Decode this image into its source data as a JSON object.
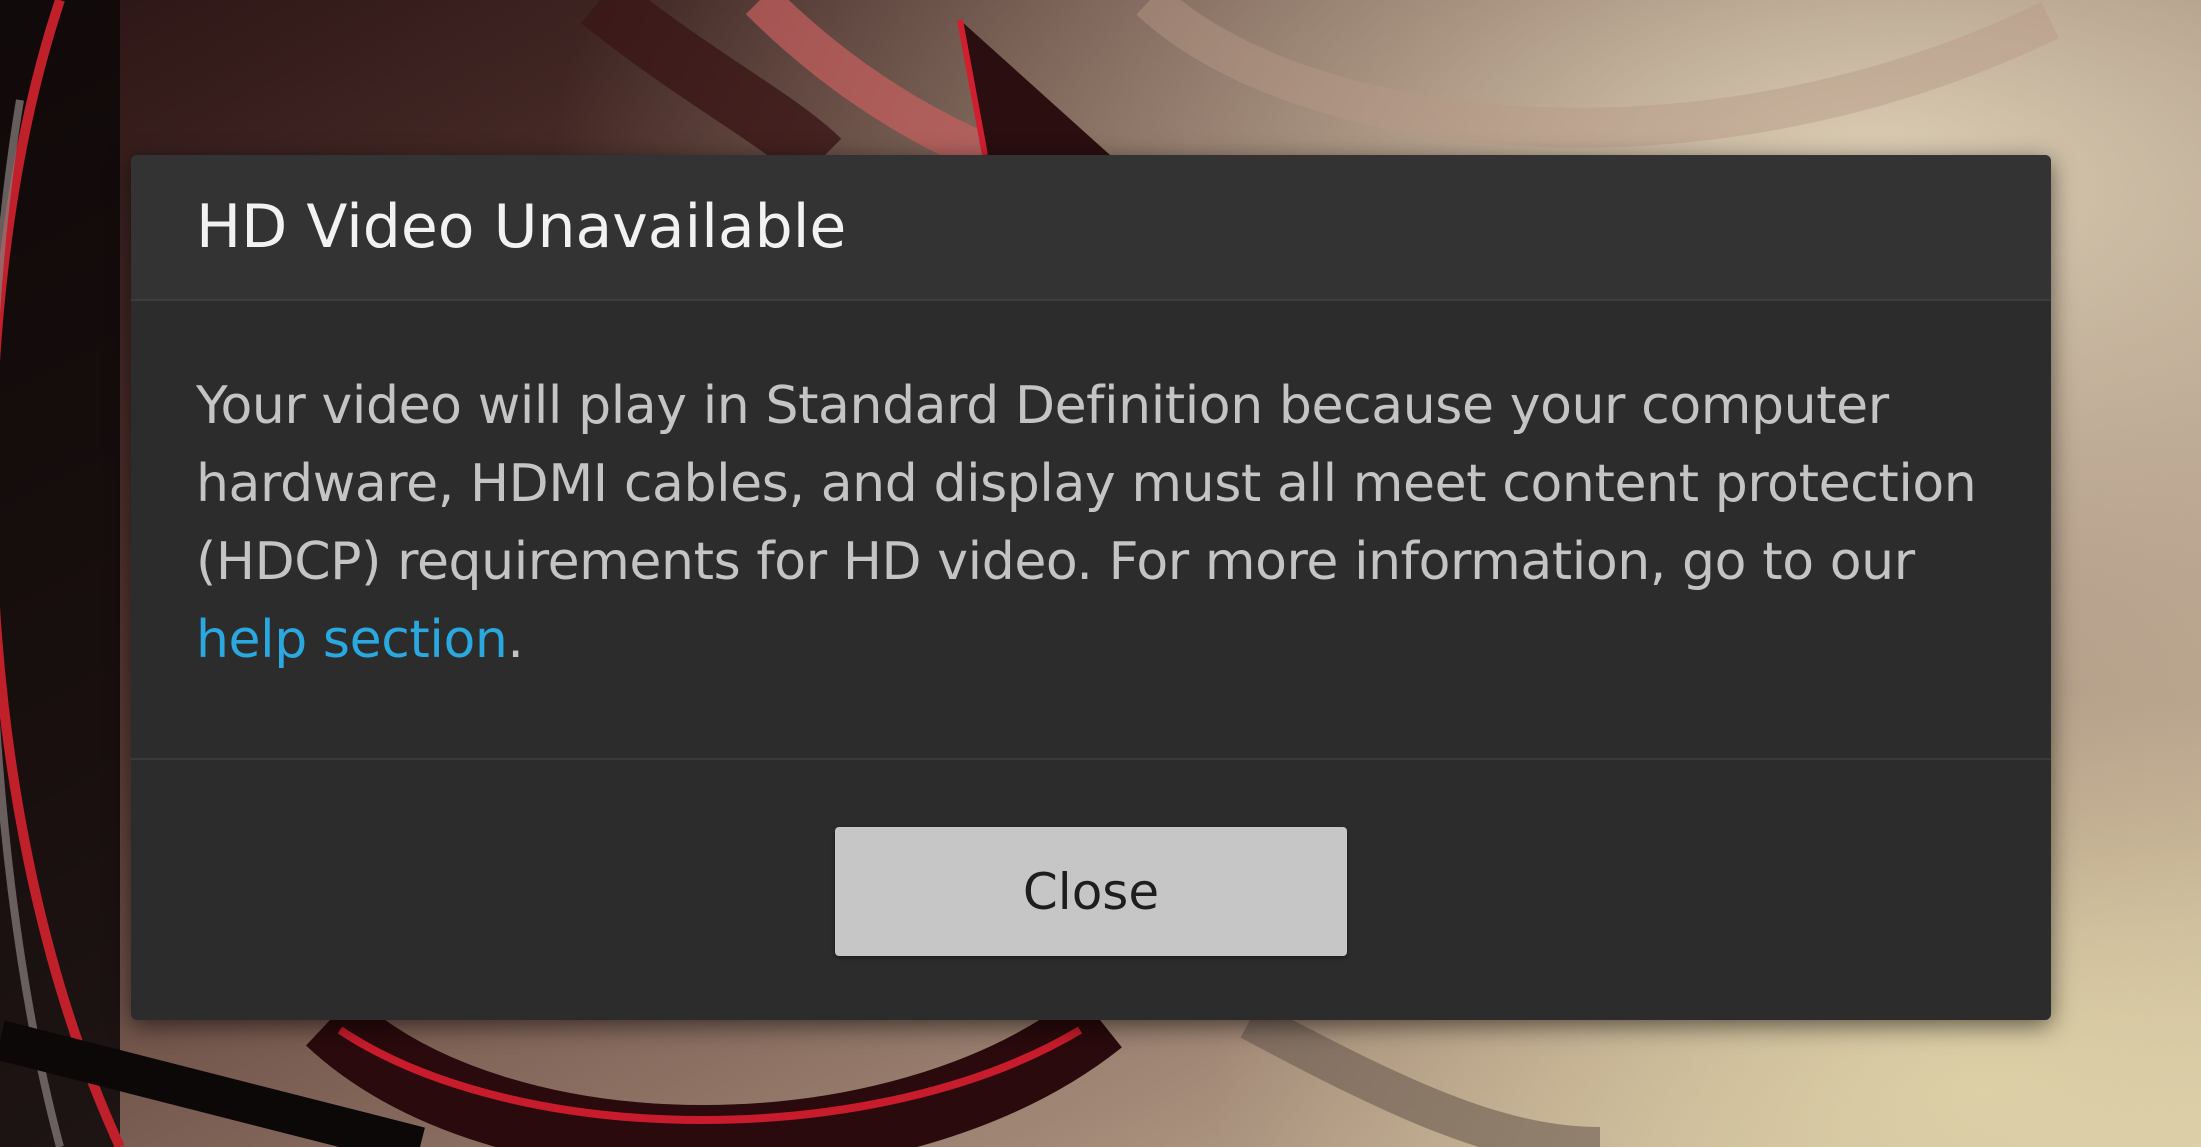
{
  "dialog": {
    "title": "HD Video Unavailable",
    "message_before_link": "Your video will play in Standard Definition because your computer hardware, HDMI cables, and display must all meet content protection (HDCP) requirements for HD video. For more information, go to our ",
    "link_text": "help section",
    "message_after_link": ".",
    "close_label": "Close"
  },
  "colors": {
    "dialog_background": "#2c2c2c",
    "header_background": "#333333",
    "title_text": "#f2f2f2",
    "body_text": "#c4c4c4",
    "link": "#2aa8e0",
    "button_background": "#c6c6c6",
    "button_text": "#1e1e1e"
  }
}
